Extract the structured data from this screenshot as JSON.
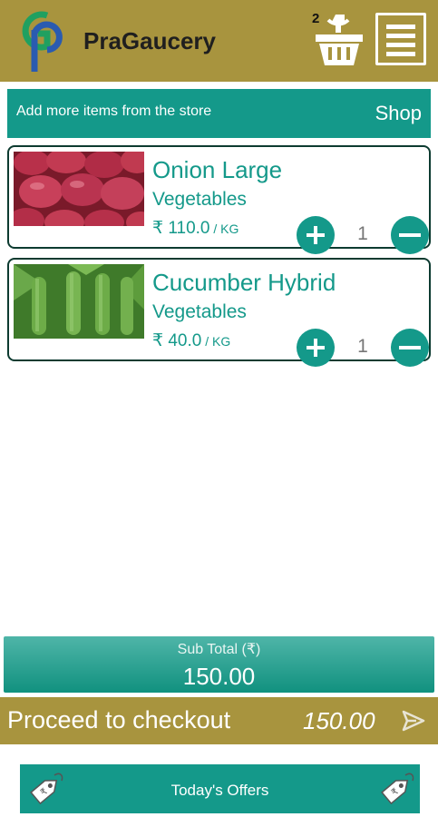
{
  "header": {
    "app_title": "PraGaucery",
    "cart_count": "2",
    "logo_icon": "gp-logo-icon",
    "cart_icon": "shopping-basket-icon",
    "menu_icon": "menu-icon"
  },
  "store_bar": {
    "text": "Add more items from the store",
    "shop_label": "Shop"
  },
  "items": [
    {
      "name": "Onion Large",
      "category": "Vegetables",
      "price": "₹ 110.0",
      "unit": " / KG",
      "quantity": "1",
      "image": "onion-image"
    },
    {
      "name": "Cucumber Hybrid",
      "category": "Vegetables",
      "price": "₹ 40.0",
      "unit": " / KG",
      "quantity": "1",
      "image": "cucumber-image"
    }
  ],
  "subtotal": {
    "label": "Sub Total (₹)",
    "value": "150.00"
  },
  "checkout": {
    "label": "Proceed to checkout",
    "amount": "150.00"
  },
  "offers": {
    "label": "Today's Offers"
  },
  "colors": {
    "primary": "#14998a",
    "header": "#a8943e",
    "border": "#0d3b30"
  }
}
